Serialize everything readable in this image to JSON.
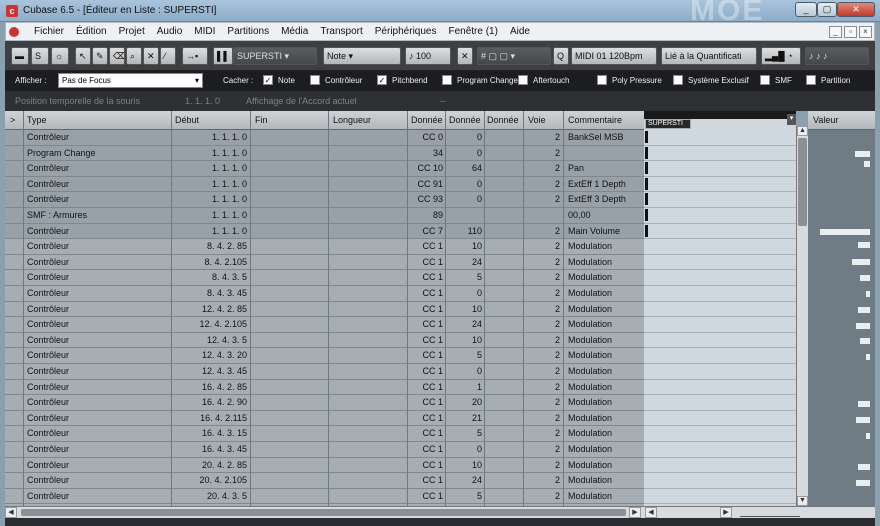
{
  "window": {
    "title": "Cubase 6.5 - [Éditeur en Liste : SUPERSTI]",
    "app_icon": "cubase-icon",
    "brand_watermark": "MOE"
  },
  "window_controls": {
    "minimize": "_",
    "restore": "▢",
    "close": "✕"
  },
  "menu": [
    "Fichier",
    "Édition",
    "Projet",
    "Audio",
    "MIDI",
    "Partitions",
    "Média",
    "Transport",
    "Périphériques",
    "Fenêtre (1)",
    "Aide"
  ],
  "menu_controls": {
    "minimize": "_",
    "restore": "▫",
    "close": "×"
  },
  "toolbar": {
    "track_name": "SUPERSTI",
    "insert_type": "Note",
    "velocity": "100",
    "quantize": "MIDI 01  120Bpm",
    "quantize_mode": "Lié à la Quantificati"
  },
  "filter": {
    "afficher_label": "Afficher :",
    "focus_value": "Pas de Focus",
    "cacher_label": "Cacher :",
    "options": [
      {
        "label": "Note",
        "checked": true
      },
      {
        "label": "Contrôleur",
        "checked": false
      },
      {
        "label": "Pitchbend",
        "checked": true
      },
      {
        "label": "Program Change",
        "checked": false
      },
      {
        "label": "Aftertouch",
        "checked": false
      },
      {
        "label": "Poly Pressure",
        "checked": false
      },
      {
        "label": "Système Exclusif",
        "checked": false
      },
      {
        "label": "SMF",
        "checked": false
      },
      {
        "label": "Partition",
        "checked": false
      }
    ]
  },
  "infobar": {
    "mouse_pos_label": "Position temporelle de la souris",
    "mouse_pos_value": "1.  1.  1.    0",
    "chord_label": "Affichage de l'Accord actuel",
    "chord_value": "--"
  },
  "table": {
    "columns": [
      "Type",
      "Début",
      "Fin",
      "Longueur",
      "Donnée",
      "Donnée",
      "Donnée",
      "Voie",
      "Commentaire"
    ],
    "expand_arrow": ">",
    "rows": [
      {
        "type": "Contrôleur",
        "debut": "1.  1.  1.    0",
        "d1": "CC 0",
        "d2": "0",
        "voie": "2",
        "comment": "BankSel MSB",
        "hl": true
      },
      {
        "type": "Program Change",
        "debut": "1.  1.  1.    0",
        "d1": "34",
        "d2": "0",
        "voie": "2",
        "comment": "",
        "hl": true
      },
      {
        "type": "Contrôleur",
        "debut": "1.  1.  1.    0",
        "d1": "CC 10",
        "d2": "64",
        "voie": "2",
        "comment": "Pan",
        "hl": true
      },
      {
        "type": "Contrôleur",
        "debut": "1.  1.  1.    0",
        "d1": "CC 91",
        "d2": "0",
        "voie": "2",
        "comment": "ExtEff 1 Depth",
        "hl": true
      },
      {
        "type": "Contrôleur",
        "debut": "1.  1.  1.    0",
        "d1": "CC 93",
        "d2": "0",
        "voie": "2",
        "comment": "ExtEff 3 Depth",
        "hl": true
      },
      {
        "type": "SMF : Armures",
        "debut": "1.  1.  1.    0",
        "d1": "89",
        "d2": "",
        "voie": "",
        "comment": "00,00",
        "hl": true
      },
      {
        "type": "Contrôleur",
        "debut": "1.  1.  1.    0",
        "d1": "CC 7",
        "d2": "110",
        "voie": "2",
        "comment": "Main Volume",
        "hl": true
      },
      {
        "type": "Contrôleur",
        "debut": "8.  4.  2.  85",
        "d1": "CC 1",
        "d2": "10",
        "voie": "2",
        "comment": "Modulation",
        "hl": false
      },
      {
        "type": "Contrôleur",
        "debut": "8.  4.  2.105",
        "d1": "CC 1",
        "d2": "24",
        "voie": "2",
        "comment": "Modulation",
        "hl": false
      },
      {
        "type": "Contrôleur",
        "debut": "8.  4.  3.    5",
        "d1": "CC 1",
        "d2": "5",
        "voie": "2",
        "comment": "Modulation",
        "hl": false
      },
      {
        "type": "Contrôleur",
        "debut": "8.  4.  3.  45",
        "d1": "CC 1",
        "d2": "0",
        "voie": "2",
        "comment": "Modulation",
        "hl": false
      },
      {
        "type": "Contrôleur",
        "debut": "12.  4.  2.  85",
        "d1": "CC 1",
        "d2": "10",
        "voie": "2",
        "comment": "Modulation",
        "hl": false
      },
      {
        "type": "Contrôleur",
        "debut": "12.  4.  2.105",
        "d1": "CC 1",
        "d2": "24",
        "voie": "2",
        "comment": "Modulation",
        "hl": false
      },
      {
        "type": "Contrôleur",
        "debut": "12.  4.  3.    5",
        "d1": "CC 1",
        "d2": "10",
        "voie": "2",
        "comment": "Modulation",
        "hl": false
      },
      {
        "type": "Contrôleur",
        "debut": "12.  4.  3.  20",
        "d1": "CC 1",
        "d2": "5",
        "voie": "2",
        "comment": "Modulation",
        "hl": false
      },
      {
        "type": "Contrôleur",
        "debut": "12.  4.  3.  45",
        "d1": "CC 1",
        "d2": "0",
        "voie": "2",
        "comment": "Modulation",
        "hl": false
      },
      {
        "type": "Contrôleur",
        "debut": "16.  4.  2.  85",
        "d1": "CC 1",
        "d2": "1",
        "voie": "2",
        "comment": "Modulation",
        "hl": false
      },
      {
        "type": "Contrôleur",
        "debut": "16.  4.  2.  90",
        "d1": "CC 1",
        "d2": "20",
        "voie": "2",
        "comment": "Modulation",
        "hl": false
      },
      {
        "type": "Contrôleur",
        "debut": "16.  4.  2.115",
        "d1": "CC 1",
        "d2": "21",
        "voie": "2",
        "comment": "Modulation",
        "hl": false
      },
      {
        "type": "Contrôleur",
        "debut": "16.  4.  3.  15",
        "d1": "CC 1",
        "d2": "5",
        "voie": "2",
        "comment": "Modulation",
        "hl": false
      },
      {
        "type": "Contrôleur",
        "debut": "16.  4.  3.  45",
        "d1": "CC 1",
        "d2": "0",
        "voie": "2",
        "comment": "Modulation",
        "hl": false
      },
      {
        "type": "Contrôleur",
        "debut": "20.  4.  2.  85",
        "d1": "CC 1",
        "d2": "10",
        "voie": "2",
        "comment": "Modulation",
        "hl": false
      },
      {
        "type": "Contrôleur",
        "debut": "20.  4.  2.105",
        "d1": "CC 1",
        "d2": "24",
        "voie": "2",
        "comment": "Modulation",
        "hl": false
      },
      {
        "type": "Contrôleur",
        "debut": "20.  4.  3.    5",
        "d1": "CC 1",
        "d2": "5",
        "voie": "2",
        "comment": "Modulation",
        "hl": false
      }
    ]
  },
  "part_label": "SUPERSTI",
  "value_column": "Valeur",
  "colors": {
    "row_highlight": "#98a1a7",
    "row_normal": "#a7aeb3",
    "toolbar": "#3d3f43",
    "filter_bar": "#1c1d20"
  }
}
